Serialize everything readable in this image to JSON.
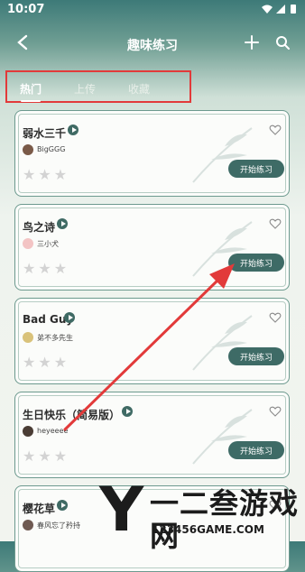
{
  "status": {
    "time": "10:07"
  },
  "header": {
    "title": "趣味练习"
  },
  "tabs": [
    {
      "label": "热门",
      "active": true
    },
    {
      "label": "上传",
      "active": false
    },
    {
      "label": "收藏",
      "active": false
    }
  ],
  "songs": [
    {
      "title": "弱水三千",
      "author": "BigGGG",
      "rating": 0,
      "button": "开始练习",
      "avatar_color": "#7a5a48"
    },
    {
      "title": "鸟之诗",
      "author": "三小犬",
      "rating": 0,
      "button": "开始练习",
      "avatar_color": "#f3c4c4"
    },
    {
      "title": "Bad Guy",
      "author": "弟不多先生",
      "rating": 0,
      "button": "开始练习",
      "avatar_color": "#d9c27a"
    },
    {
      "title": "生日快乐（简易版）",
      "author": "heyeeee",
      "rating": 0,
      "button": "开始练习",
      "avatar_color": "#4a3c34"
    },
    {
      "title": "樱花草",
      "author": "春风忘了矜持",
      "rating": 0,
      "button": "开始练习",
      "avatar_color": "#6f5a52"
    }
  ],
  "watermark": {
    "letter": "Y",
    "text": "一二叁游戏网",
    "url": "123456GAME.COM"
  },
  "colors": {
    "accent": "#3e6b66",
    "highlight_box": "#e23a3a",
    "arrow": "#e23a3a"
  }
}
